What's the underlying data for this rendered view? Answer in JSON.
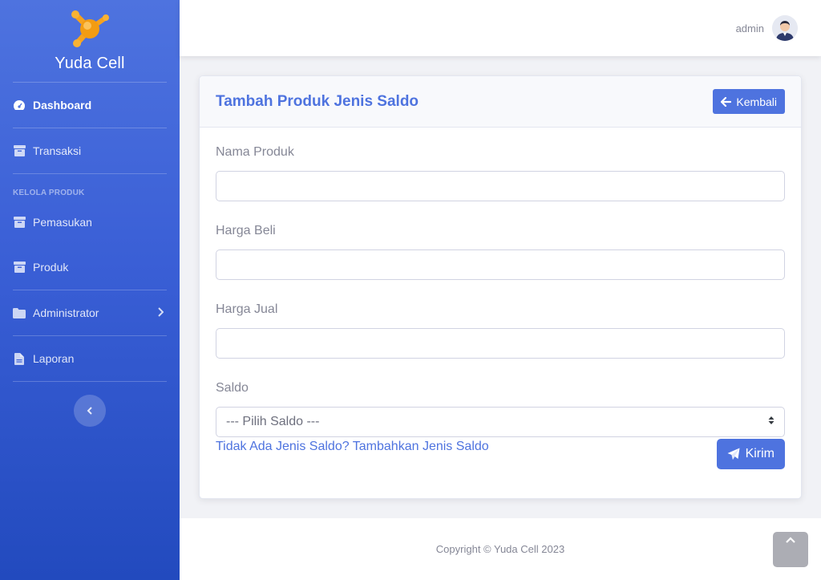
{
  "brand": {
    "name": "Yuda Cell",
    "logo_icon": "molecule-logo-icon"
  },
  "sidebar": {
    "items": [
      {
        "label": "Dashboard",
        "icon": "tachometer-icon",
        "active": true
      },
      {
        "label": "Transaksi",
        "icon": "box-icon"
      },
      {
        "label": "Pemasukan",
        "icon": "box-icon"
      },
      {
        "label": "Produk",
        "icon": "box-icon"
      },
      {
        "label": "Administrator",
        "icon": "folder-icon",
        "has_submenu": true
      },
      {
        "label": "Laporan",
        "icon": "file-icon"
      }
    ],
    "heading": "KELOLA PRODUK",
    "toggle_icon": "chevron-left-icon"
  },
  "topbar": {
    "user_name": "admin",
    "avatar_icon": "user-avatar"
  },
  "card": {
    "title": "Tambah Produk Jenis Saldo",
    "back_label": "Kembali",
    "fields": [
      {
        "label": "Nama Produk",
        "value": ""
      },
      {
        "label": "Harga Beli",
        "value": ""
      },
      {
        "label": "Harga Jual",
        "value": ""
      },
      {
        "label": "Saldo",
        "selected": "--- Pilih Saldo ---"
      }
    ],
    "add_link": "Tidak Ada Jenis Saldo? Tambahkan Jenis Saldo",
    "submit_label": "Kirim"
  },
  "footer": {
    "copyright": "Copyright © Yuda Cell 2023"
  },
  "colors": {
    "primary": "#4e73df",
    "sidebar_end": "#224abe",
    "muted": "#858796"
  }
}
